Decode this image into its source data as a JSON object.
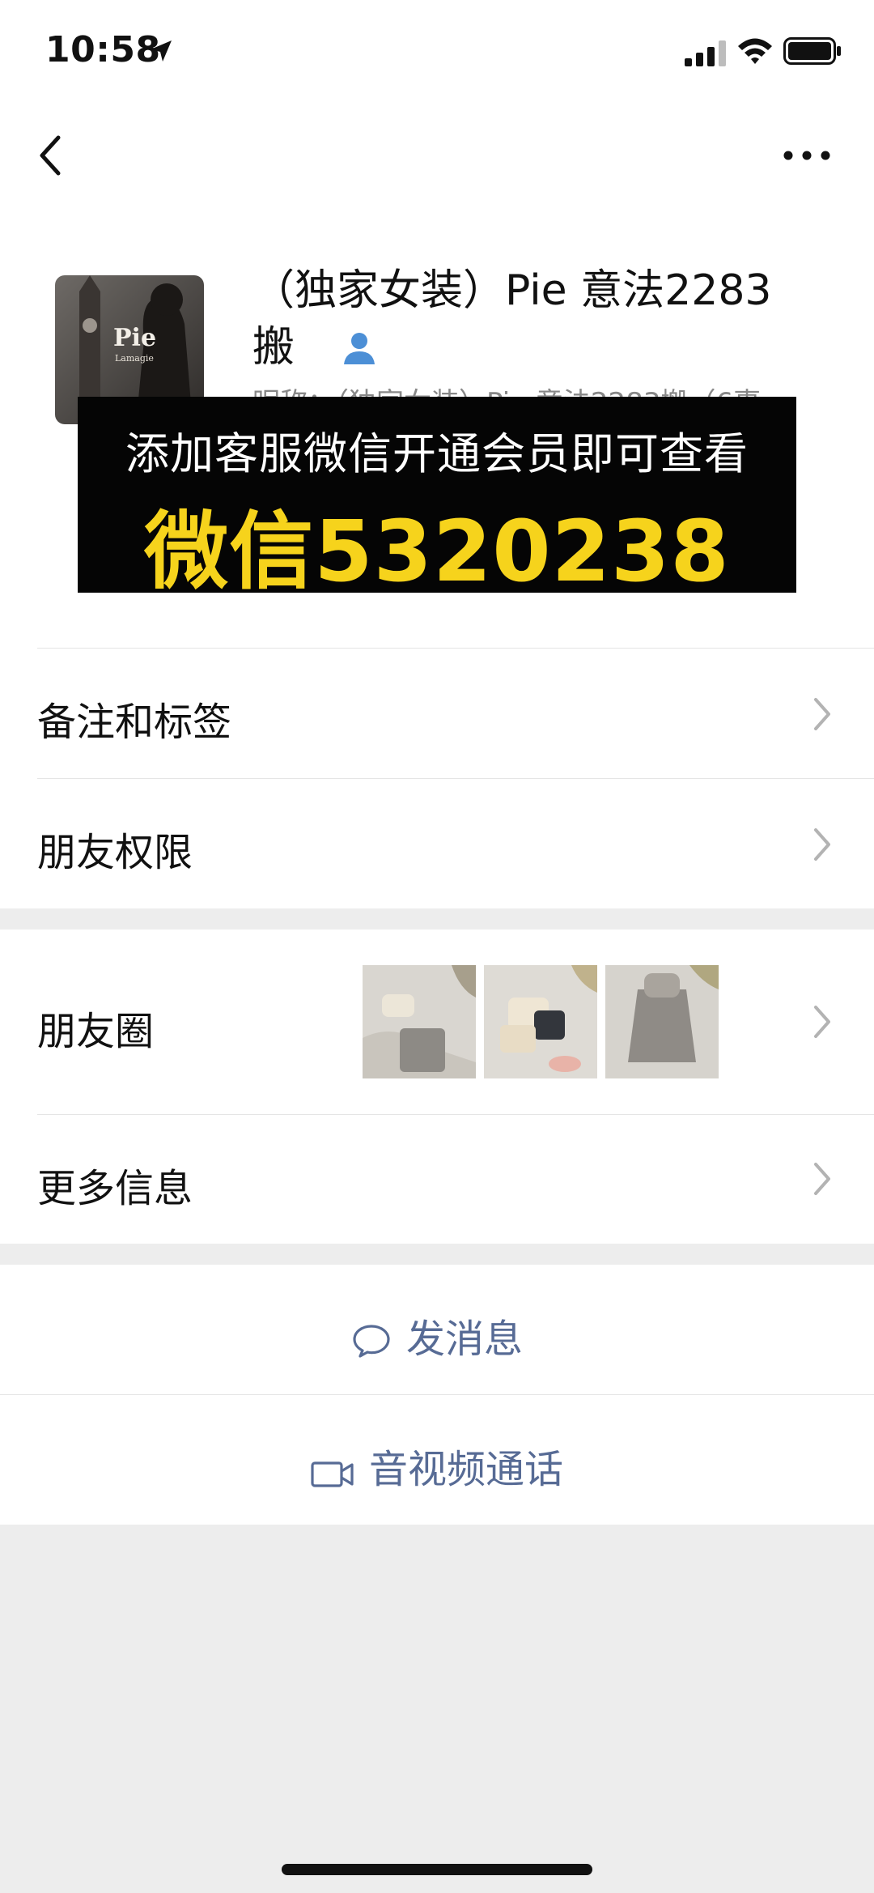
{
  "status_bar": {
    "time": "10:58"
  },
  "profile": {
    "name_line1": "（独家女装）Pie 意法2283",
    "name_line2": "搬",
    "nickname_partial": "昵称：（独家女装）Pie 意法2283搬（6事",
    "avatar_brand": "Pie",
    "avatar_sub": "Lamagie"
  },
  "ad_banner": {
    "line1": "添加客服微信开通会员即可查看",
    "line2": "微信5320238",
    "accent_color": "#f6d31c"
  },
  "cells": {
    "remarks_tags": "备注和标签",
    "friend_permissions": "朋友权限",
    "moments": "朋友圈",
    "more_info": "更多信息"
  },
  "actions": {
    "send_message": "发消息",
    "voice_video_call": "音视频通话"
  },
  "colors": {
    "background": "#ededed",
    "link_blue": "#576b95",
    "badge_blue": "#4c8fd6"
  }
}
